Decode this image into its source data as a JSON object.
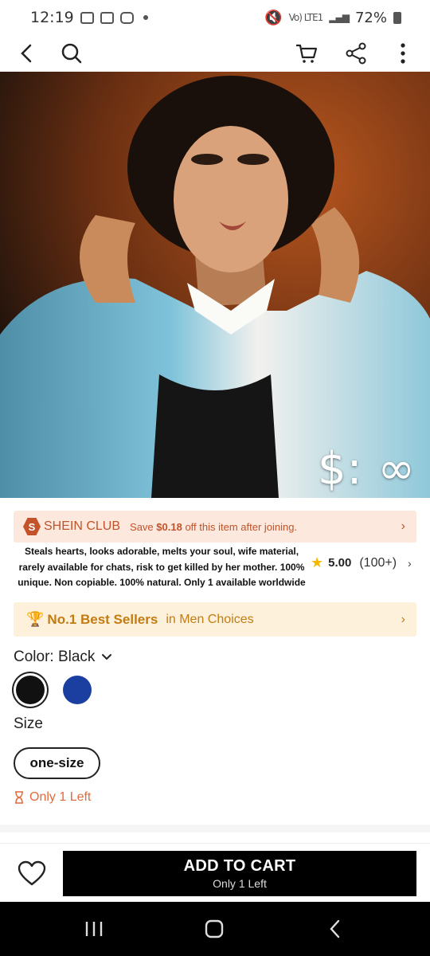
{
  "status_bar": {
    "time": "12:19",
    "battery": "72%",
    "network": "Vo) LTE1"
  },
  "nav": {
    "back_icon": "chevron-left-icon",
    "search_icon": "search-icon",
    "cart_icon": "cart-icon",
    "share_icon": "share-icon",
    "more_icon": "more-vertical-icon"
  },
  "hero": {
    "price_overlay": "$: ∞"
  },
  "club": {
    "badge": "S",
    "name": "SHEIN CLUB",
    "text_prefix": "Save ",
    "amount": "$0.18",
    "text_suffix": " off this item after joining."
  },
  "product": {
    "description": "Steals hearts, looks adorable, melts your soul, wife material, rarely available for chats, risk to get killed by her mother. 100% unique. Non copiable. 100% natural. Only 1 available worldwide",
    "rating": "5.00",
    "review_count": "(100+)"
  },
  "best_seller": {
    "title": "No.1 Best Sellers",
    "category": "in Men Choices"
  },
  "color": {
    "label": "Color: Black",
    "options": [
      "Black",
      "Blue"
    ],
    "colors": {
      "black": "#111111",
      "blue": "#1b3fa0"
    }
  },
  "size": {
    "label": "Size",
    "selected": "one-size"
  },
  "stock": {
    "text": "Only 1 Left"
  },
  "cart": {
    "button_label": "ADD TO CART",
    "sub_label": "Only 1 Left"
  },
  "colors": {
    "accent_orange": "#c2532a",
    "banner_pink": "#fde8dd",
    "banner_gold": "#fdf1dc",
    "gold_text": "#c27c12",
    "stock_red": "#e36a3d"
  }
}
